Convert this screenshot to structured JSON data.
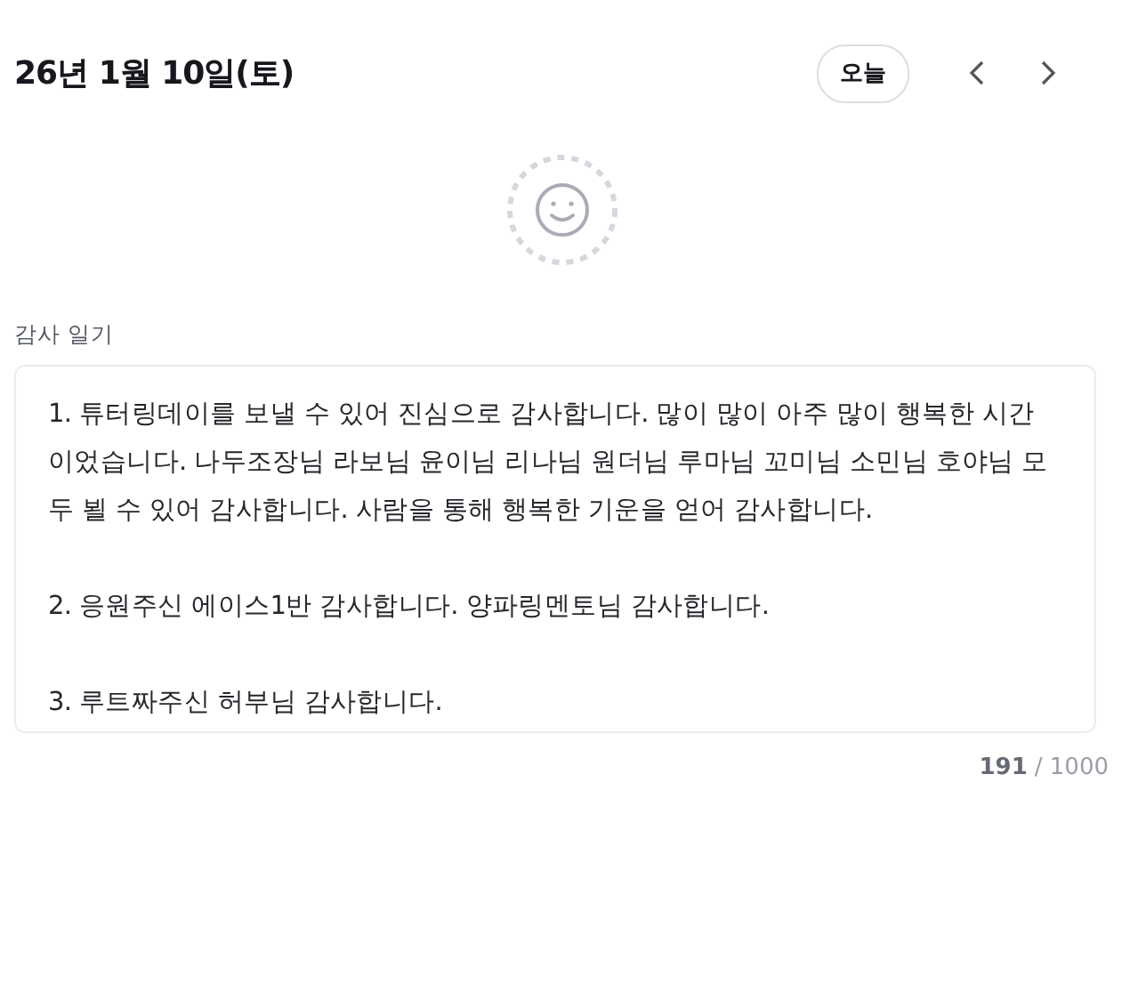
{
  "header": {
    "date": "26년 1월 10일(토)",
    "today_button": "오늘"
  },
  "section_label": "감사 일기",
  "diary": {
    "value": "1. 튜터링데이를 보낼 수 있어 진심으로 감사합니다. 많이 많이 아주 많이 행복한 시간 이었습니다. 나두조장님 라보님 윤이님 리나님 원더님 루마님 꼬미님 소민님 호야님 모두 뵐 수 있어 감사합니다. 사람을 통해 행복한 기운을 얻어 감사합니다.\n\n2. 응원주신 에이스1반 감사합니다. 양파링멘토님 감사합니다.\n\n3. 루트짜주신 허부님 감사합니다."
  },
  "counter": {
    "count": "191",
    "max": "/ 1000"
  }
}
